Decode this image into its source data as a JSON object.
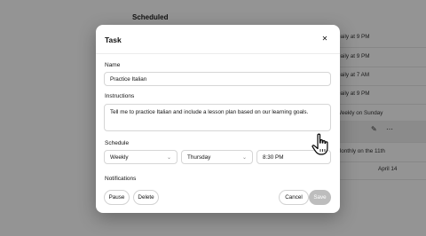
{
  "background": {
    "title": "Scheduled",
    "rows": [
      {
        "text": "Daily at 9 PM",
        "icon": "repeat-icon"
      },
      {
        "text": "Daily at 9 PM",
        "icon": "repeat-icon"
      },
      {
        "text": "Daily at 7 AM",
        "icon": "repeat-icon"
      },
      {
        "text": "Daily at 9 PM",
        "icon": "repeat-icon"
      },
      {
        "text": "Weekly on Sunday",
        "icon": "repeat-icon"
      },
      {
        "text": "",
        "icon": ""
      },
      {
        "text": "Monthly on the 11th",
        "icon": "repeat-icon"
      },
      {
        "text": "April 14",
        "icon": ""
      }
    ],
    "row_actions": {
      "edit_icon": "pencil-icon",
      "more_icon": "more-icon"
    }
  },
  "modal": {
    "title": "Task",
    "close_icon": "close-icon",
    "name": {
      "label": "Name",
      "value": "Practice Italian"
    },
    "instructions": {
      "label": "Instructions",
      "value": "Tell me to practice Italian and include a lesson plan based on our learning goals."
    },
    "schedule": {
      "label": "Schedule",
      "frequency": "Weekly",
      "day": "Thursday",
      "time": "8:30 PM"
    },
    "notifications": {
      "label": "Notifications"
    },
    "buttons": {
      "pause": "Pause",
      "delete": "Delete",
      "cancel": "Cancel",
      "save": "Save"
    }
  },
  "cursor": {
    "icon": "hand-pointer-icon"
  }
}
